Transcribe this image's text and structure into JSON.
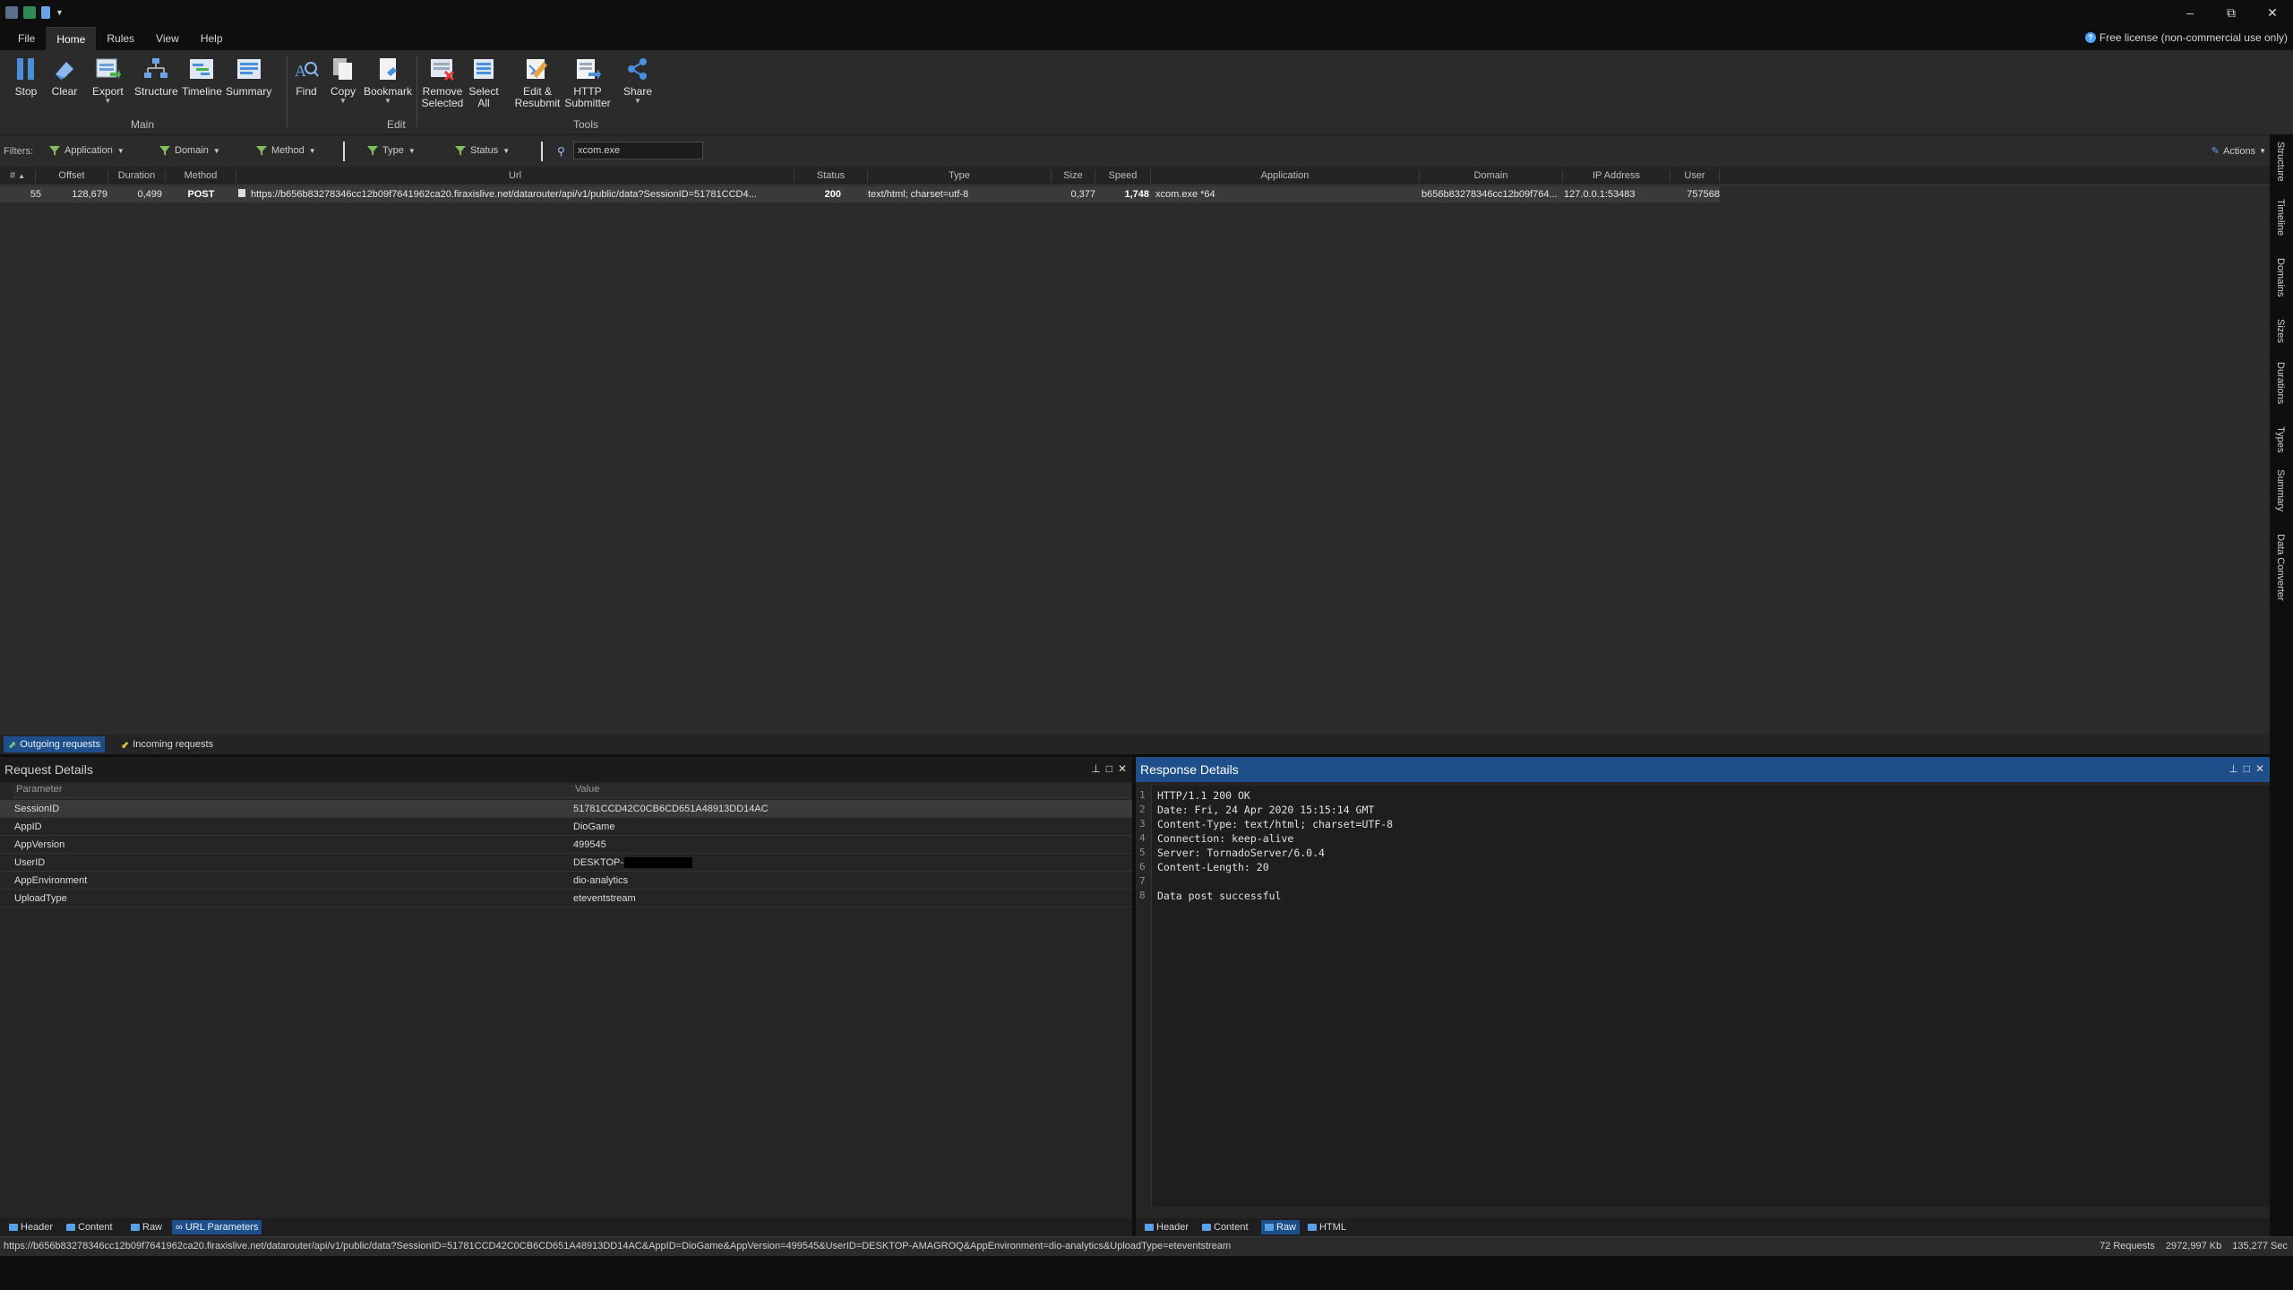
{
  "window": {
    "minimize": "–",
    "maximize": "⧉",
    "close": "✕"
  },
  "menu": {
    "tabs": [
      "File",
      "Home",
      "Rules",
      "View",
      "Help"
    ],
    "active": "Home",
    "license": "Free license (non-commercial use only)"
  },
  "ribbon": {
    "main": [
      "Stop",
      "Clear",
      "Export",
      "Structure",
      "Timeline",
      "Summary"
    ],
    "edit": [
      "Find",
      "Copy",
      "Bookmark"
    ],
    "tools": [
      "Remove Selected",
      "Select All",
      "Edit & Resubmit",
      "HTTP Submitter",
      "Share"
    ],
    "groups": {
      "main": "Main",
      "edit": "Edit",
      "tools": "Tools"
    }
  },
  "filters": {
    "label": "Filters:",
    "items": [
      "Application",
      "Domain",
      "Method",
      "Type",
      "Status"
    ],
    "search_value": "xcom.exe",
    "actions": "Actions"
  },
  "grid": {
    "columns": [
      "#",
      "Offset",
      "Duration",
      "Method",
      "Url",
      "Status",
      "Type",
      "Size",
      "Speed",
      "Application",
      "Domain",
      "IP Address",
      "User"
    ],
    "rows": [
      {
        "num": "55",
        "offset": "128,679",
        "duration": "0,499",
        "method": "POST",
        "url": "https://b656b83278346cc12b09f7641962ca20.firaxislive.net/datarouter/api/v1/public/data?SessionID=51781CCD4...",
        "status": "200",
        "type": "text/html; charset=utf-8",
        "size": "0,377",
        "speed": "1,748",
        "application": "xcom.exe *64",
        "domain": "b656b83278346cc12b09f764...",
        "ip": "127.0.0.1:53483",
        "user": "757568"
      }
    ],
    "tabs": [
      "Outgoing requests",
      "Incoming requests"
    ]
  },
  "vtabs": [
    "Structure",
    "Timeline",
    "Domains",
    "Sizes",
    "Durations",
    "Types",
    "Summary",
    "Data Converter"
  ],
  "request": {
    "title": "Request Details",
    "headers": [
      "Parameter",
      "Value"
    ],
    "params": [
      {
        "name": "SessionID",
        "value": "51781CCD42C0CB6CD651A48913DD14AC"
      },
      {
        "name": "AppID",
        "value": "DioGame"
      },
      {
        "name": "AppVersion",
        "value": "499545"
      },
      {
        "name": "UserID",
        "value": "DESKTOP-"
      },
      {
        "name": "AppEnvironment",
        "value": "dio-analytics"
      },
      {
        "name": "UploadType",
        "value": "eteventstream"
      }
    ],
    "tabs": [
      "Header",
      "Content",
      "Raw",
      "URL Parameters"
    ]
  },
  "response": {
    "title": "Response Details",
    "lines": [
      "HTTP/1.1 200 OK",
      "Date: Fri, 24 Apr 2020 15:15:14 GMT",
      "Content-Type: text/html; charset=UTF-8",
      "Connection: keep-alive",
      "Server: TornadoServer/6.0.4",
      "Content-Length: 20",
      "",
      "Data post successful"
    ],
    "tabs": [
      "Header",
      "Content",
      "Raw",
      "HTML"
    ]
  },
  "status": {
    "url": "https://b656b83278346cc12b09f7641962ca20.firaxislive.net/datarouter/api/v1/public/data?SessionID=51781CCD42C0CB6CD651A48913DD14AC&AppID=DioGame&AppVersion=499545&UserID=DESKTOP-AMAGROQ&AppEnvironment=dio-analytics&UploadType=eteventstream",
    "requests": "72 Requests",
    "kb": "2972,997 Kb",
    "sec": "135,277 Sec"
  }
}
